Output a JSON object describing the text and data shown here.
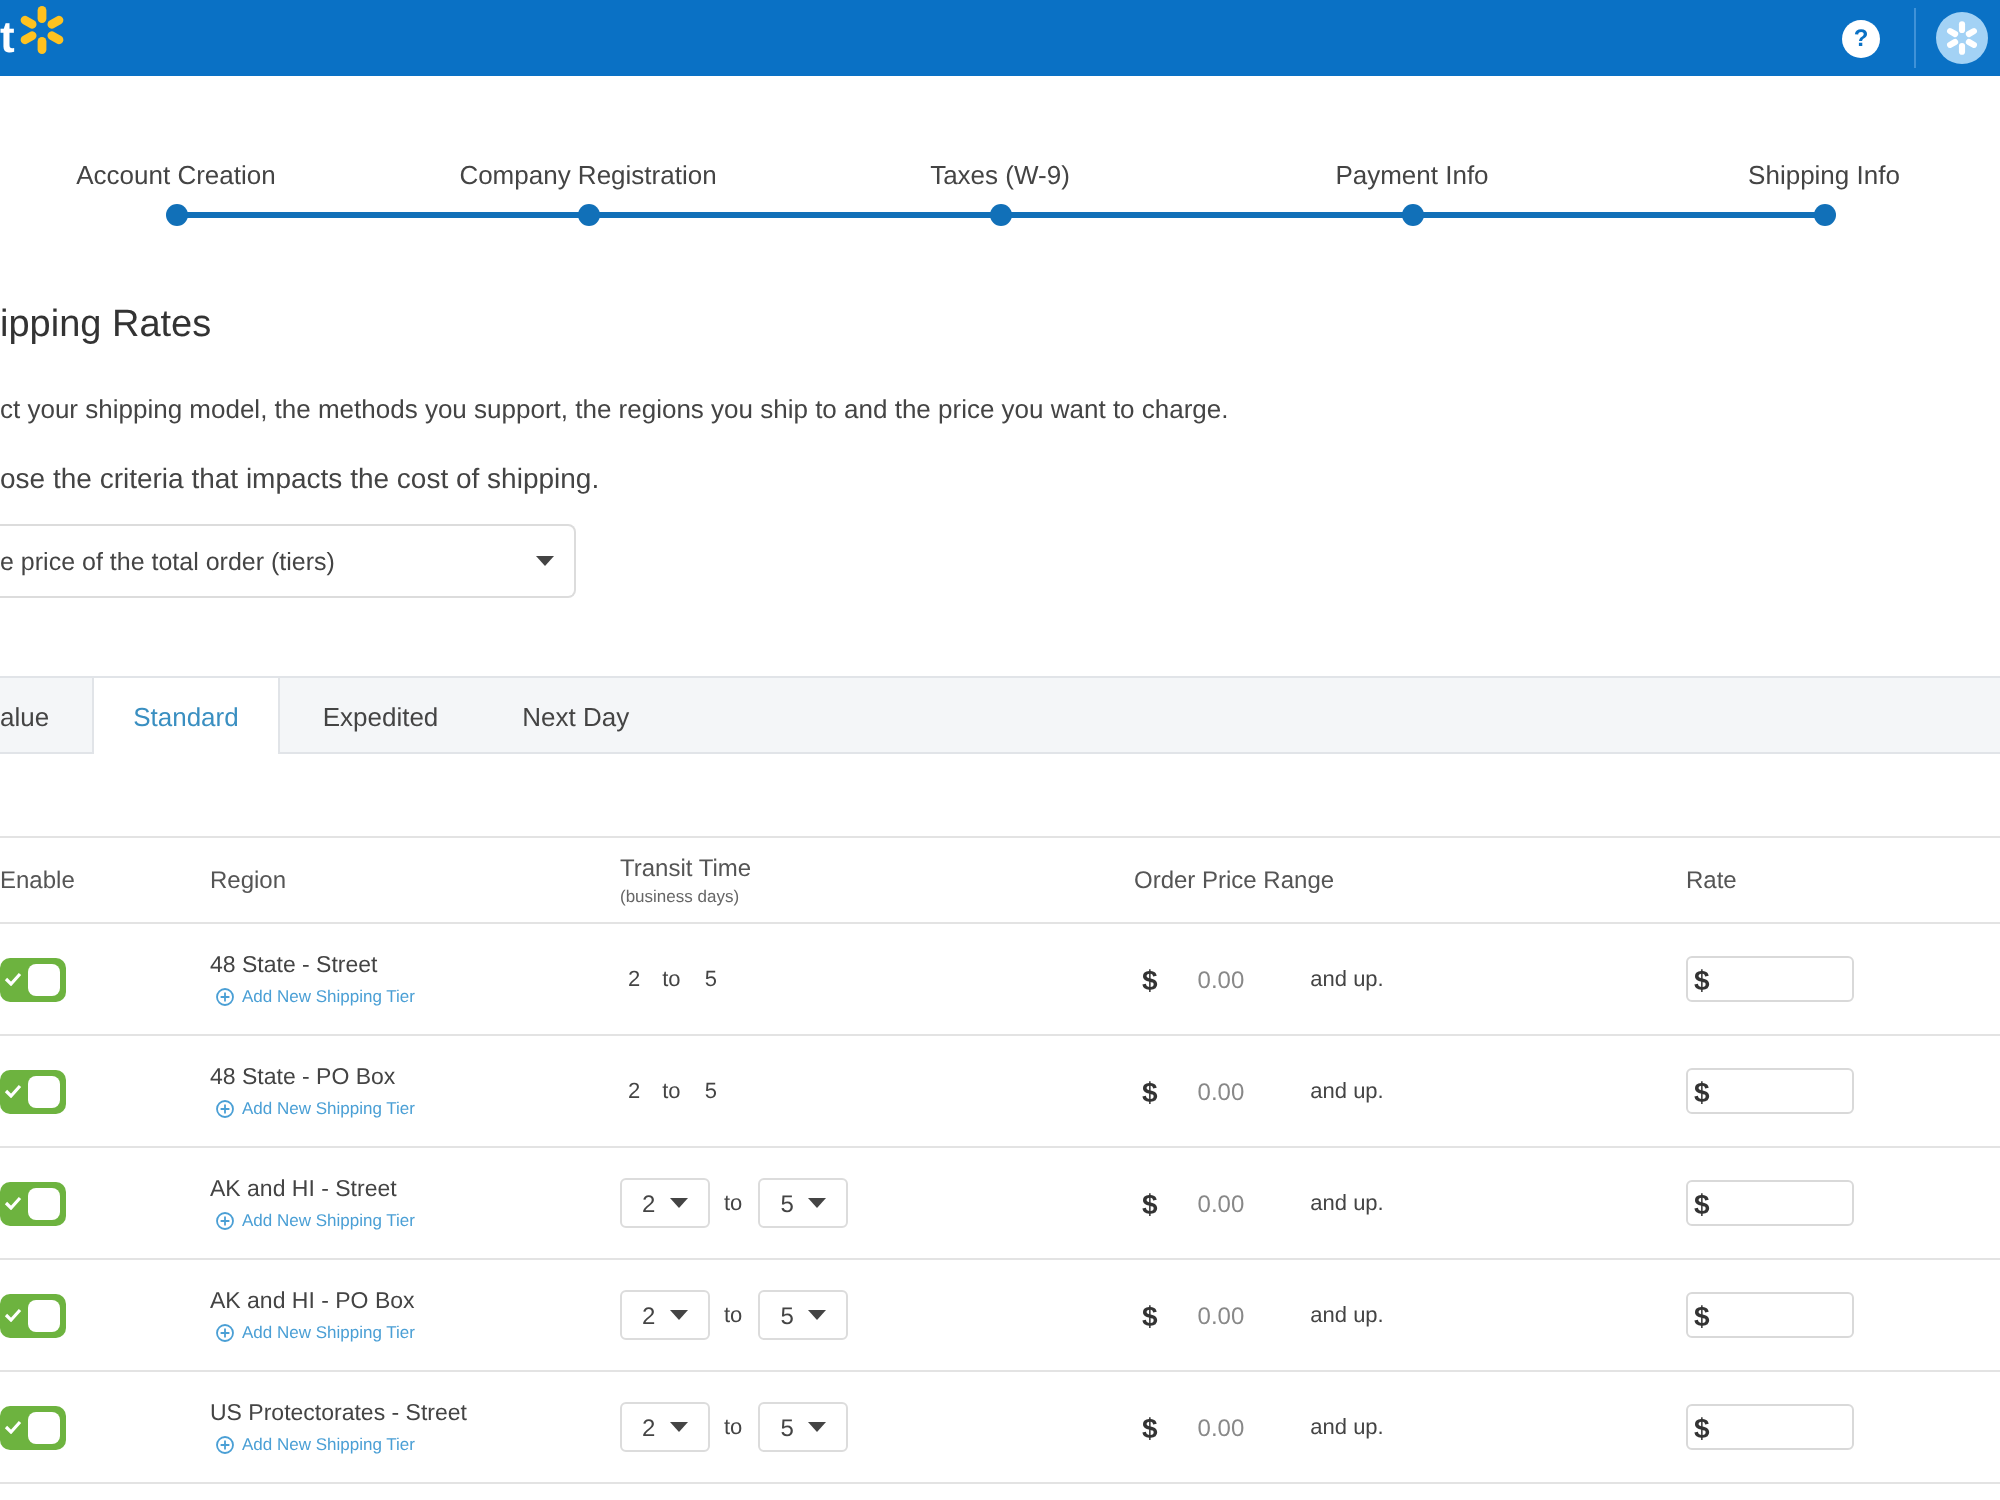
{
  "header": {
    "logo_text": "t",
    "help": "?"
  },
  "steps": [
    {
      "label": "Account Creation"
    },
    {
      "label": "Company Registration"
    },
    {
      "label": "Taxes (W-9)"
    },
    {
      "label": "Payment Info"
    },
    {
      "label": "Shipping Info"
    }
  ],
  "page": {
    "title": "ipping Rates",
    "description": "ct your shipping model, the methods you support, the regions you ship to and the price you want to charge.",
    "criteria_prompt": "ose the criteria that impacts the cost of shipping.",
    "criteria_select": {
      "value": "e price of the total order (tiers)"
    }
  },
  "tabs": [
    {
      "label": "alue",
      "selected": false
    },
    {
      "label": "Standard",
      "selected": true
    },
    {
      "label": "Expedited",
      "selected": false
    },
    {
      "label": "Next Day",
      "selected": false
    }
  ],
  "table": {
    "columns": [
      {
        "label": "Enable"
      },
      {
        "label": "Region"
      },
      {
        "label": "Transit Time",
        "sublabel": "(business days)"
      },
      {
        "label": "Order Price Range"
      },
      {
        "label": "Rate"
      }
    ],
    "rows": [
      {
        "enabled": true,
        "region": "48 State - Street",
        "add_link": "Add New Shipping Tier",
        "transit": {
          "kind": "text",
          "from": "2",
          "joiner": "to",
          "to": "5"
        },
        "currency": "$",
        "min_price": "0.00",
        "price_suffix": "and up.",
        "rate_prefix": "$"
      },
      {
        "enabled": true,
        "region": "48 State - PO Box",
        "add_link": "Add New Shipping Tier",
        "transit": {
          "kind": "text",
          "from": "2",
          "joiner": "to",
          "to": "5"
        },
        "currency": "$",
        "min_price": "0.00",
        "price_suffix": "and up.",
        "rate_prefix": "$"
      },
      {
        "enabled": true,
        "region": "AK and HI - Street",
        "add_link": "Add New Shipping Tier",
        "transit": {
          "kind": "select",
          "from": "2",
          "joiner": "to",
          "to": "5"
        },
        "currency": "$",
        "min_price": "0.00",
        "price_suffix": "and up.",
        "rate_prefix": "$"
      },
      {
        "enabled": true,
        "region": "AK and HI - PO Box",
        "add_link": "Add New Shipping Tier",
        "transit": {
          "kind": "select",
          "from": "2",
          "joiner": "to",
          "to": "5"
        },
        "currency": "$",
        "min_price": "0.00",
        "price_suffix": "and up.",
        "rate_prefix": "$"
      },
      {
        "enabled": true,
        "region": "US Protectorates - Street",
        "add_link": "Add New Shipping Tier",
        "transit": {
          "kind": "select",
          "from": "2",
          "joiner": "to",
          "to": "5"
        },
        "currency": "$",
        "min_price": "0.00",
        "price_suffix": "and up.",
        "rate_prefix": "$"
      }
    ]
  }
}
